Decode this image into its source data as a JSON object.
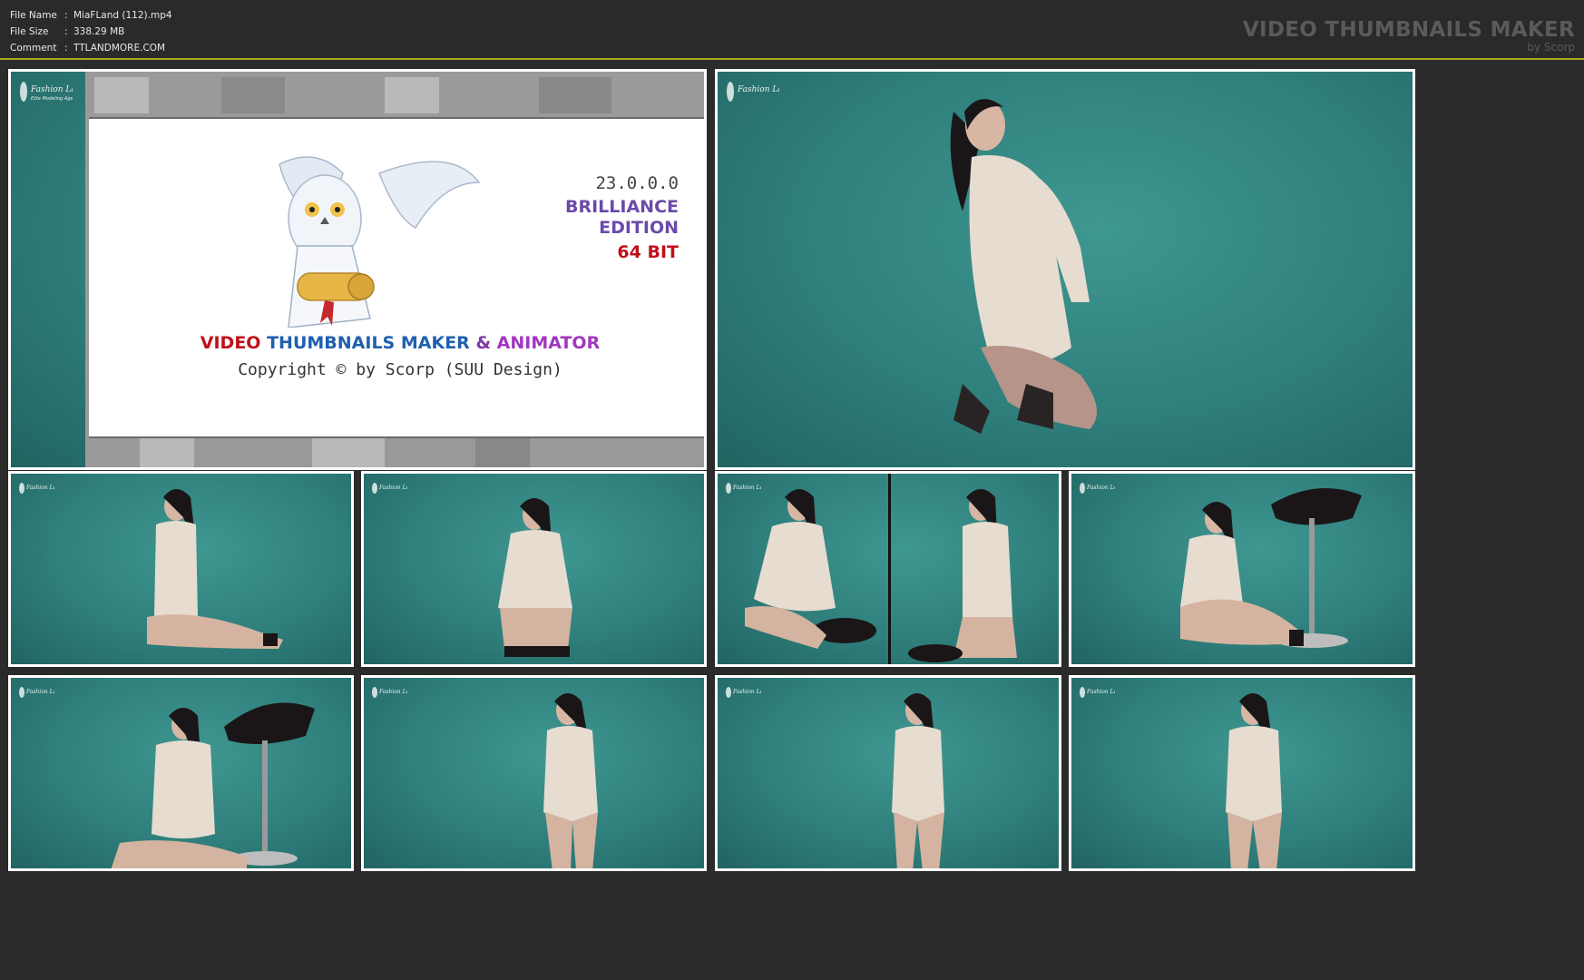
{
  "file_info": {
    "rows": [
      {
        "key": "File Name",
        "value": "MiaFLand (112).mp4"
      },
      {
        "key": "File Size",
        "value": "338.29 MB"
      },
      {
        "key": "Comment",
        "value": "TTLANDMORE.COM"
      }
    ]
  },
  "brand": {
    "title": "VIDEO THUMBNAILS MAKER",
    "subtitle": "by Scorp"
  },
  "splash": {
    "version": "23.0.0.0",
    "edition_line1": "BRILLIANCE",
    "edition_line2": "EDITION",
    "bits": "64 BIT",
    "product_word1": "VIDEO",
    "product_word2": "THUMBNAILS MAKER",
    "product_word3": "&",
    "product_word4": "ANIMATOR",
    "copyright": "Copyright © by Scorp (SUU Design)"
  },
  "colors": {
    "accent_border": "#a7a71a",
    "backdrop": "#2f7f7c",
    "frame": "#ffffff"
  },
  "thumbnails": [
    {
      "name": "thumb-1",
      "kind": "splash"
    },
    {
      "name": "thumb-2",
      "kind": "kneeling-pose"
    },
    {
      "name": "thumb-3",
      "kind": "seated-floor-pose"
    },
    {
      "name": "thumb-4",
      "kind": "seated-stool-pose"
    },
    {
      "name": "thumb-5",
      "kind": "split-stool-pose"
    },
    {
      "name": "thumb-6",
      "kind": "floor-stool-pose"
    },
    {
      "name": "thumb-7",
      "kind": "floor-wave-pose"
    },
    {
      "name": "thumb-8",
      "kind": "standing-pose"
    },
    {
      "name": "thumb-9",
      "kind": "standing-pose"
    },
    {
      "name": "thumb-10",
      "kind": "standing-pose"
    }
  ]
}
